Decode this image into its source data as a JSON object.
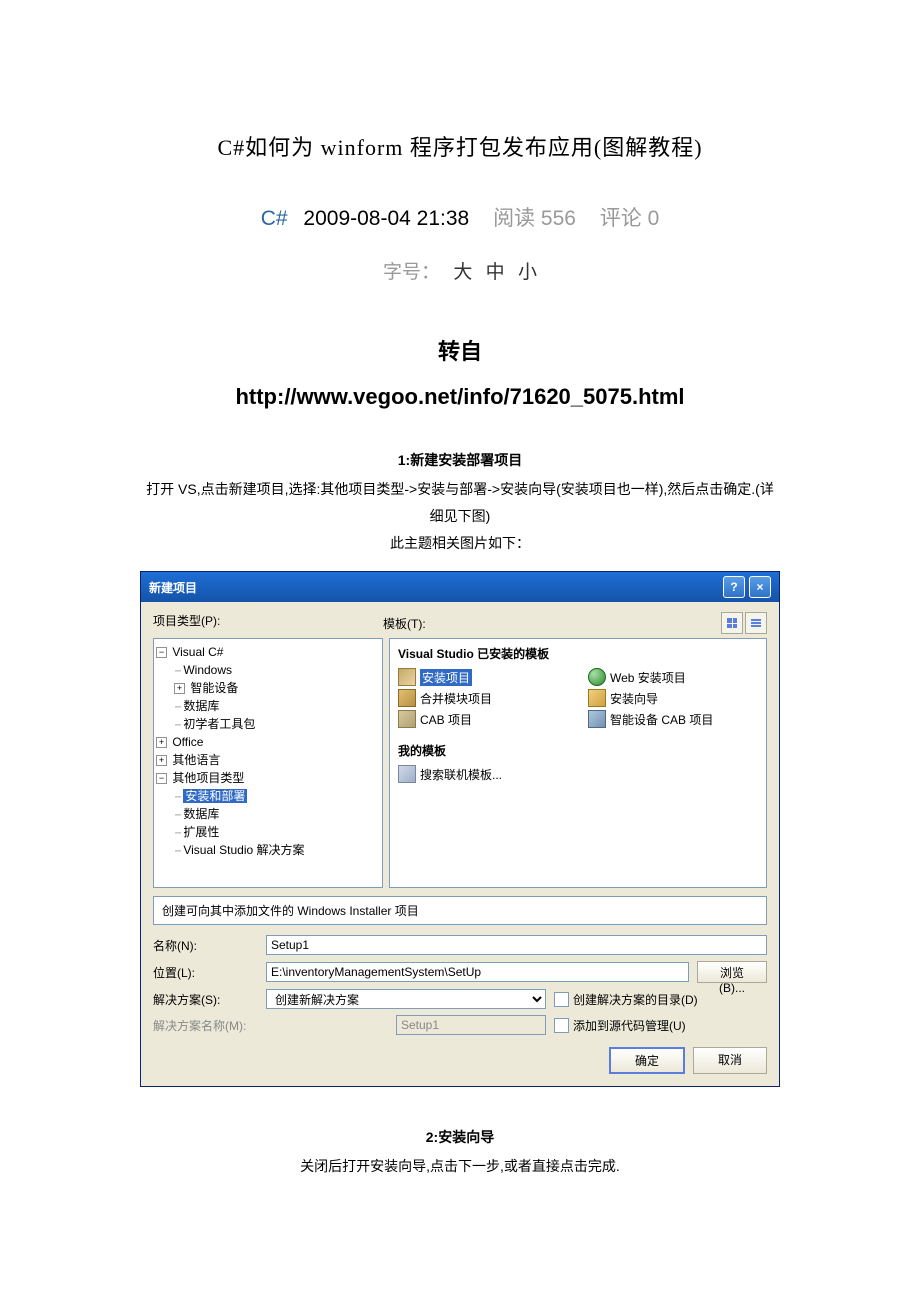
{
  "article": {
    "title": "C#如何为 winform 程序打包发布应用(图解教程)",
    "category": "C#",
    "date": "2009-08-04 21:38",
    "reads_label": "阅读 556",
    "comments_label": "评论 0",
    "font_label": "字号：",
    "font_large": "大",
    "font_medium": "中",
    "font_small": "小",
    "source_label": "转自",
    "source_url": "http://www.vegoo.net/info/71620_5075.html"
  },
  "section1": {
    "num": "1:",
    "title": "新建安装部署项目",
    "body": "打开 VS,点击新建项目,选择:其他项目类型->安装与部署->安装向导(安装项目也一样),然后点击确定.(详细见下图)",
    "caption": "此主题相关图片如下："
  },
  "dialog": {
    "title": "新建项目",
    "help_icon": "?",
    "close_icon": "×",
    "type_label": "项目类型(P):",
    "template_label": "模板(T):",
    "tree": {
      "vc": "Visual C#",
      "windows": "Windows",
      "smart": "智能设备",
      "db": "数据库",
      "starter": "初学者工具包",
      "office": "Office",
      "other_lang": "其他语言",
      "other_proj": "其他项目类型",
      "setup": "安装和部署",
      "db2": "数据库",
      "ext": "扩展性",
      "sln": "Visual Studio 解决方案"
    },
    "templates": {
      "installed_header": "Visual Studio 已安装的模板",
      "items": {
        "setup_proj": "安装项目",
        "web_setup": "Web 安装项目",
        "merge": "合并模块项目",
        "wizard": "安装向导",
        "cab": "CAB 项目",
        "smart_cab": "智能设备 CAB 项目"
      },
      "my_header": "我的模板",
      "search_online": "搜索联机模板..."
    },
    "description": "创建可向其中添加文件的 Windows Installer 项目",
    "name_label": "名称(N):",
    "name_value": "Setup1",
    "location_label": "位置(L):",
    "location_value": "E:\\inventoryManagementSystem\\SetUp",
    "browse_label": "浏览(B)...",
    "solution_label": "解决方案(S):",
    "solution_value": "创建新解决方案",
    "create_dir_label": "创建解决方案的目录(D)",
    "solution_name_label": "解决方案名称(M):",
    "solution_name_value": "Setup1",
    "add_scm_label": "添加到源代码管理(U)",
    "ok": "确定",
    "cancel": "取消"
  },
  "section2": {
    "num": "2:",
    "title": "安装向导",
    "body": "关闭后打开安装向导,点击下一步,或者直接点击完成."
  }
}
